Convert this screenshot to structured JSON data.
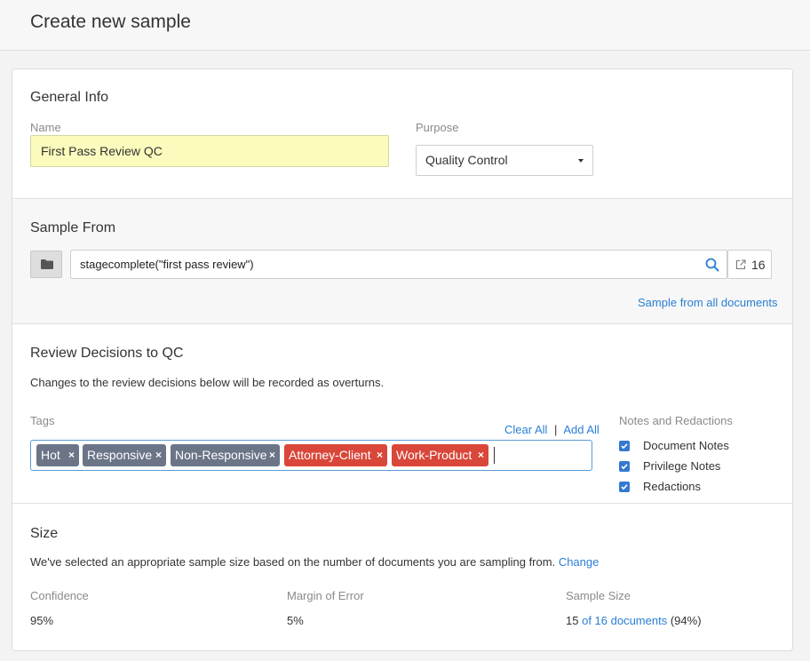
{
  "page": {
    "title": "Create new sample"
  },
  "general": {
    "title": "General Info",
    "name_label": "Name",
    "name_value": "First Pass Review QC",
    "purpose_label": "Purpose",
    "purpose_value": "Quality Control"
  },
  "sample_from": {
    "title": "Sample From",
    "query": "stagecomplete(\"first pass review\")",
    "count": "16",
    "all_docs_link": "Sample from all documents"
  },
  "review": {
    "title": "Review Decisions to QC",
    "description": "Changes to the review decisions below will be recorded as overturns.",
    "tags_label": "Tags",
    "clear_all": "Clear All",
    "separator": "|",
    "add_all": "Add All",
    "tags": [
      {
        "label": "Hot",
        "color": "#6b7587"
      },
      {
        "label": "Responsive",
        "color": "#6b7587"
      },
      {
        "label": "Non-Responsive",
        "color": "#6b7587"
      },
      {
        "label": "Attorney-Client",
        "color": "#d9473a"
      },
      {
        "label": "Work-Product",
        "color": "#d9473a"
      }
    ],
    "remove_symbol": "×",
    "notes_label": "Notes and Redactions",
    "notes_options": [
      {
        "label": "Document Notes",
        "checked": true
      },
      {
        "label": "Privilege Notes",
        "checked": true
      },
      {
        "label": "Redactions",
        "checked": true
      }
    ]
  },
  "size": {
    "title": "Size",
    "description": "We've selected an appropriate sample size based on the number of documents you are sampling from.",
    "change_link": "Change",
    "confidence_label": "Confidence",
    "confidence_value": "95%",
    "margin_label": "Margin of Error",
    "margin_value": "5%",
    "sample_size_label": "Sample Size",
    "sample_count": "15",
    "sample_of": "of 16 documents",
    "sample_percent": "(94%)"
  },
  "colors": {
    "accent": "#2a7fd4",
    "checkbox": "#3479d0",
    "name_highlight": "#fbfbbd"
  }
}
